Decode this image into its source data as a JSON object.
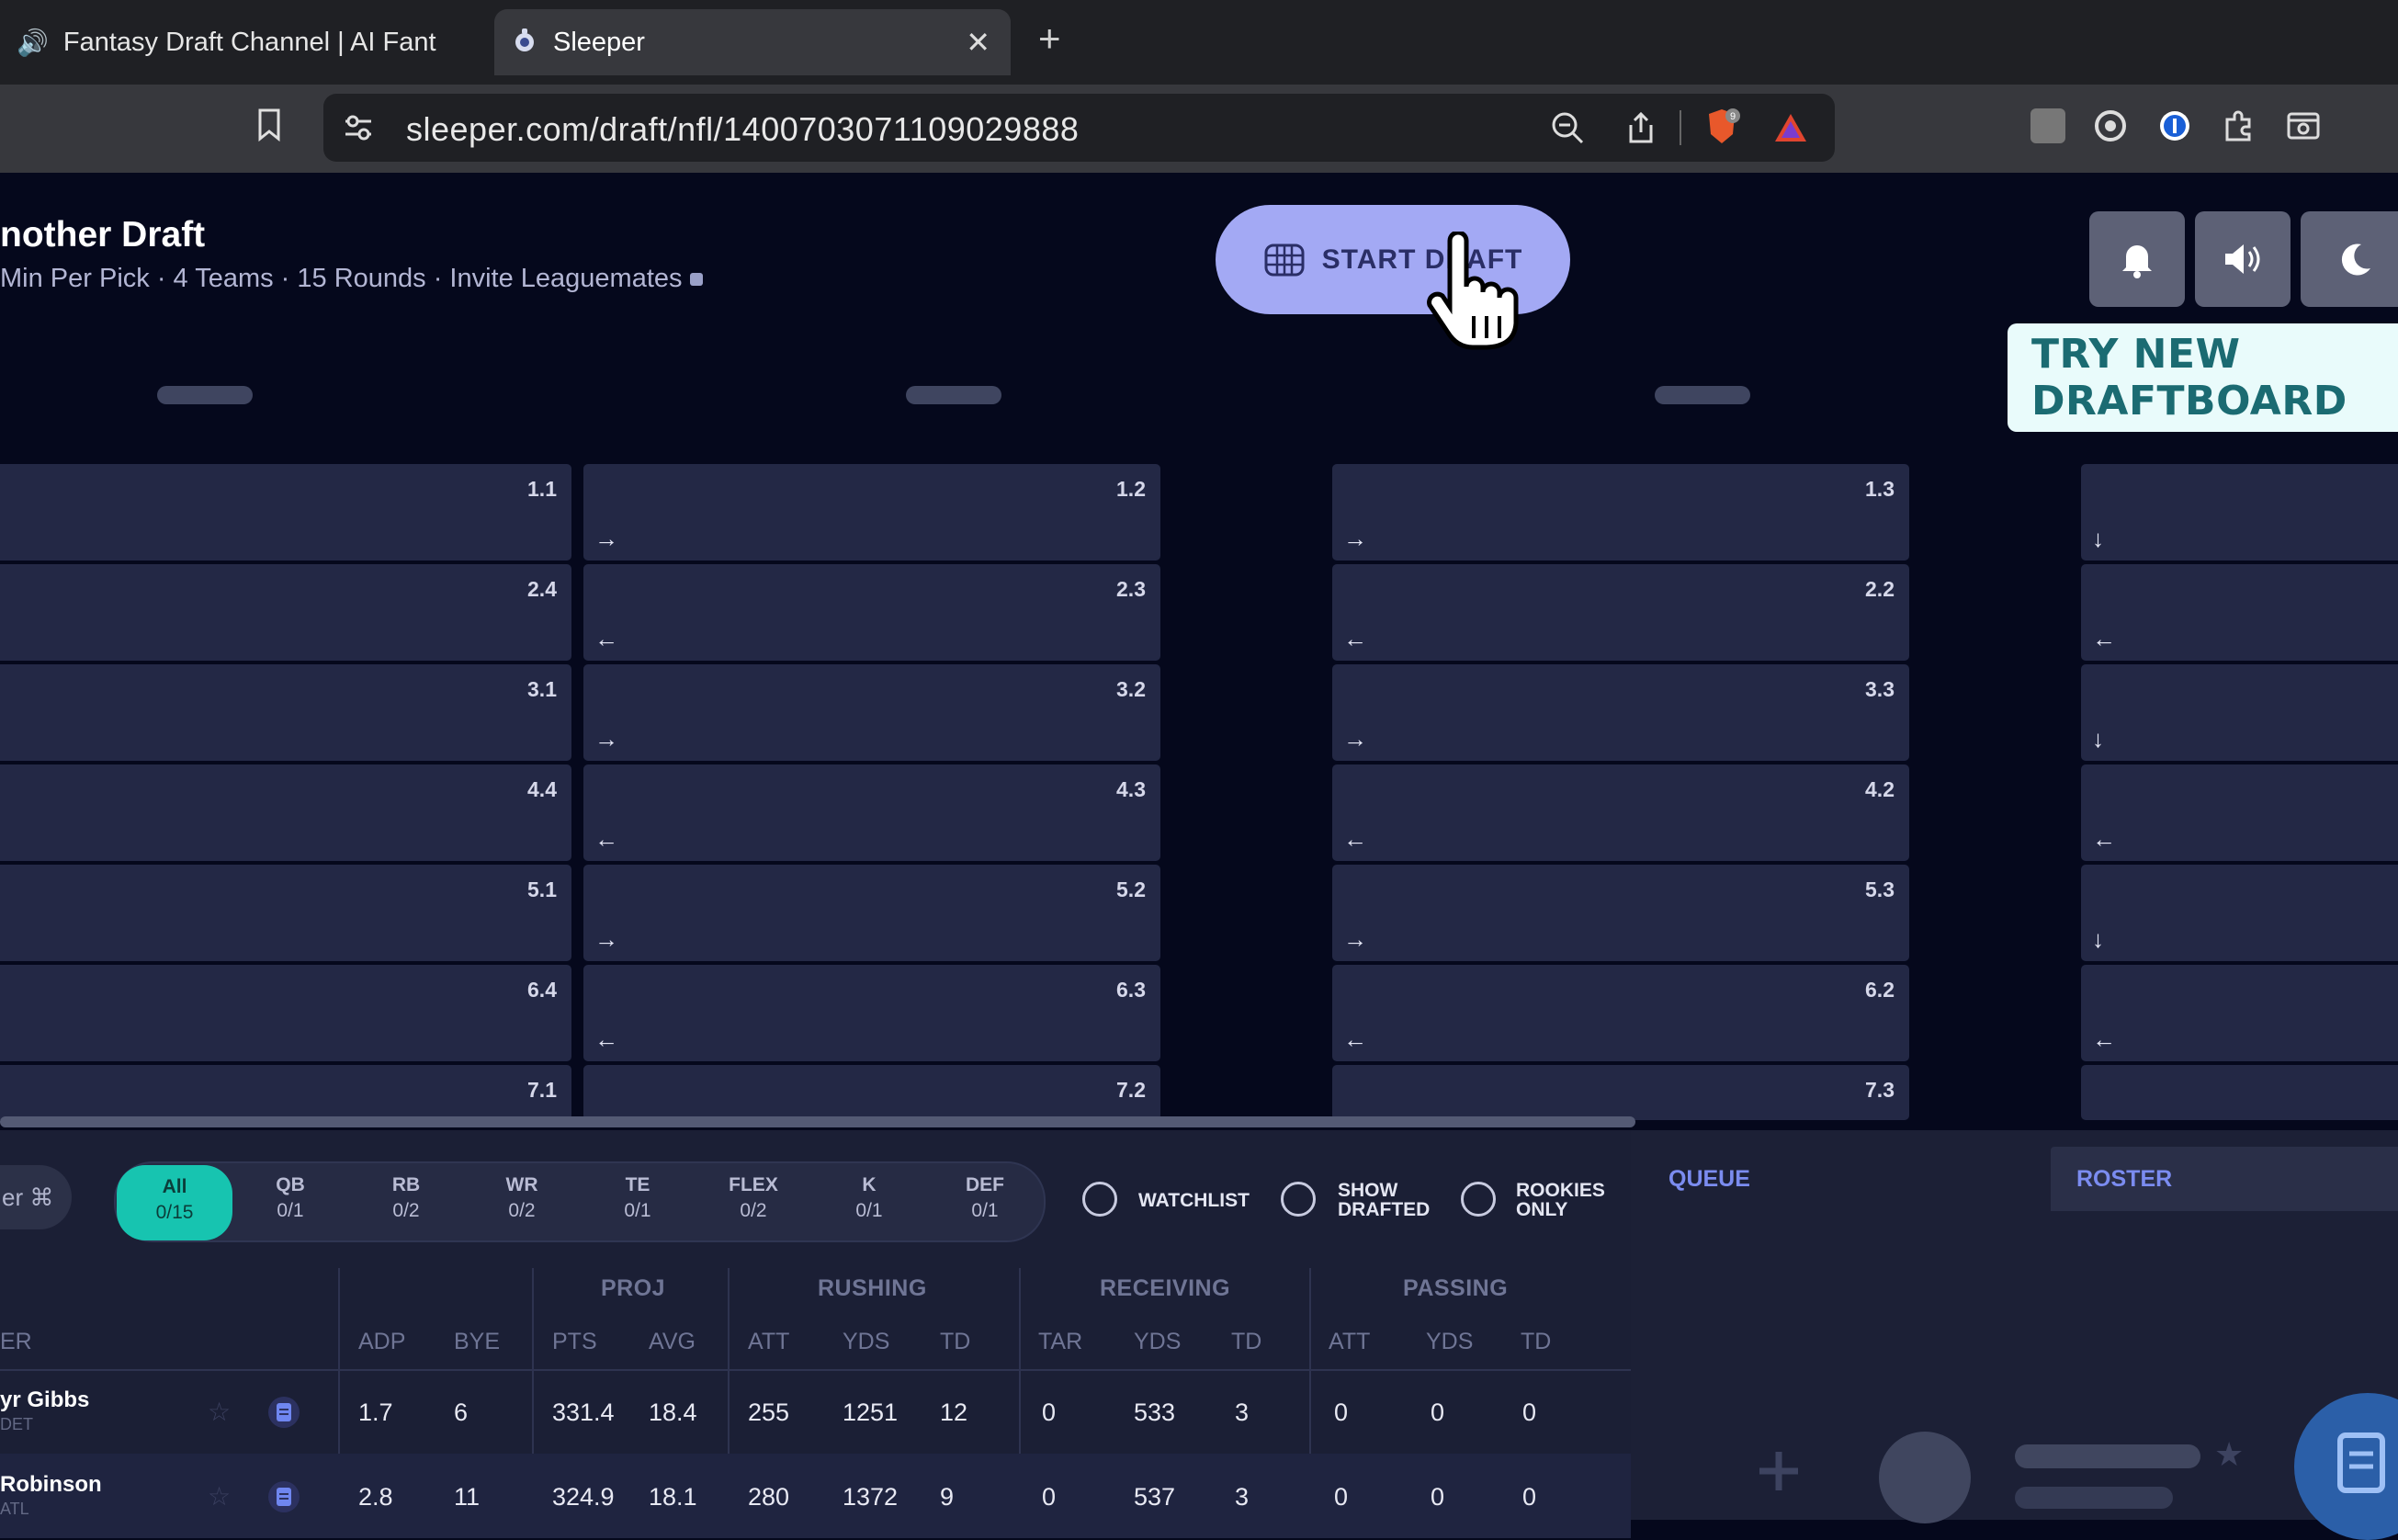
{
  "browser": {
    "tabs": [
      {
        "label": "Fantasy Draft Channel | AI Fant",
        "active": false
      },
      {
        "label": "Sleeper",
        "active": true
      }
    ],
    "url": "sleeper.com/draft/nfl/1400703071109029888",
    "extension_badge": "9"
  },
  "draft": {
    "title": "nother Draft",
    "subtitle": "Min Per Pick · 4 Teams · 15 Rounds · Invite Leaguemates",
    "start_label": "START DRAFT",
    "try_board_label": "TRY NEW DRAFTBOARD"
  },
  "board": {
    "rows": [
      {
        "picks": [
          "1.1",
          "1.2",
          "1.3"
        ],
        "arrows": [
          "",
          "→",
          "→",
          "↓"
        ]
      },
      {
        "picks": [
          "2.4",
          "2.3",
          "2.2"
        ],
        "arrows": [
          "",
          "←",
          "←",
          "←"
        ]
      },
      {
        "picks": [
          "3.1",
          "3.2",
          "3.3"
        ],
        "arrows": [
          "",
          "→",
          "→",
          "↓"
        ]
      },
      {
        "picks": [
          "4.4",
          "4.3",
          "4.2"
        ],
        "arrows": [
          "",
          "←",
          "←",
          "←"
        ]
      },
      {
        "picks": [
          "5.1",
          "5.2",
          "5.3"
        ],
        "arrows": [
          "",
          "→",
          "→",
          "↓"
        ]
      },
      {
        "picks": [
          "6.4",
          "6.3",
          "6.2"
        ],
        "arrows": [
          "",
          "←",
          "←",
          "←"
        ]
      },
      {
        "picks": [
          "7.1",
          "7.2",
          "7.3"
        ],
        "arrows": [
          "",
          "",
          "",
          ""
        ]
      }
    ]
  },
  "filters": {
    "search_tail": "er ⌘",
    "positions": [
      {
        "label": "All",
        "count": "0/15",
        "active": true
      },
      {
        "label": "QB",
        "count": "0/1"
      },
      {
        "label": "RB",
        "count": "0/2"
      },
      {
        "label": "WR",
        "count": "0/2"
      },
      {
        "label": "TE",
        "count": "0/1"
      },
      {
        "label": "FLEX",
        "count": "0/2"
      },
      {
        "label": "K",
        "count": "0/1"
      },
      {
        "label": "DEF",
        "count": "0/1"
      }
    ],
    "watchlist": "WATCHLIST",
    "show_drafted": [
      "SHOW",
      "DRAFTED"
    ],
    "rookies_only": [
      "ROOKIES",
      "ONLY"
    ]
  },
  "table": {
    "groups": [
      "PROJ",
      "RUSHING",
      "RECEIVING",
      "PASSING"
    ],
    "headers": [
      "ER",
      "ADP",
      "BYE",
      "PTS",
      "AVG",
      "ATT",
      "YDS",
      "TD",
      "TAR",
      "YDS",
      "TD",
      "ATT",
      "YDS",
      "TD"
    ],
    "rows": [
      {
        "name": "yr Gibbs",
        "team": "DET",
        "values": [
          "1.7",
          "6",
          "331.4",
          "18.4",
          "255",
          "1251",
          "12",
          "0",
          "533",
          "3",
          "0",
          "0",
          "0"
        ]
      },
      {
        "name": " Robinson",
        "team": "ATL",
        "values": [
          "2.8",
          "11",
          "324.9",
          "18.1",
          "280",
          "1372",
          "9",
          "0",
          "537",
          "3",
          "0",
          "0",
          "0"
        ]
      }
    ]
  },
  "side_panel": {
    "queue_tab": "QUEUE",
    "roster_tab": "ROSTER"
  },
  "colors": {
    "page_bg": "#05081c",
    "cell_bg": "#232845",
    "accent_teal": "#17c4b0",
    "start_button": "#a3a9f4",
    "tab_accent": "#7b8cf0"
  }
}
